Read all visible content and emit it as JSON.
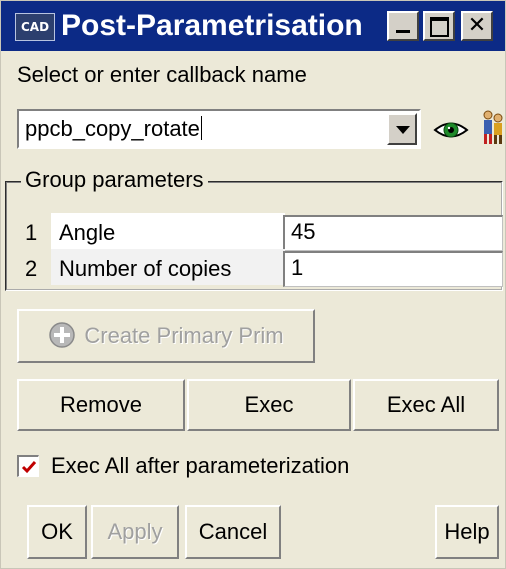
{
  "window": {
    "title": "Post-Parametrisation",
    "icon_text": "CAD",
    "controls": {
      "minimize": "minimize-icon",
      "maximize": "maximize-icon",
      "close": "✕"
    }
  },
  "callback": {
    "label": "Select or enter callback name",
    "value": "ppcb_copy_rotate",
    "icons": [
      "eye-icon",
      "people-icon"
    ]
  },
  "group": {
    "title": "Group parameters",
    "rows": [
      {
        "index": "1",
        "name": "Angle",
        "value": "45"
      },
      {
        "index": "2",
        "name": "Number of copies",
        "value": "1"
      }
    ]
  },
  "buttons": {
    "create_primary": "Create Primary Prim",
    "remove": "Remove",
    "exec": "Exec",
    "exec_all": "Exec All",
    "ok": "OK",
    "apply": "Apply",
    "cancel": "Cancel",
    "help": "Help"
  },
  "option": {
    "label": "Exec All after parameterization",
    "checked": true
  },
  "colors": {
    "titlebar": "#0c2a86",
    "window_bg": "#ece9d8",
    "check_mark": "#c00000",
    "disabled_text": "#a0a0a0"
  }
}
